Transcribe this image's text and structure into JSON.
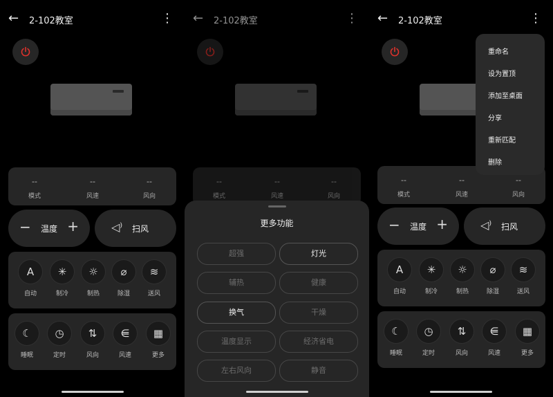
{
  "app": {
    "title": "2-102教室"
  },
  "status": [
    {
      "value": "--",
      "label": "模式"
    },
    {
      "value": "--",
      "label": "风速"
    },
    {
      "value": "--",
      "label": "风向"
    }
  ],
  "temp_label": "温度",
  "swing_label": "扫风",
  "modes": [
    {
      "icon": "A",
      "label": "自动",
      "name": "auto"
    },
    {
      "icon": "✳",
      "label": "制冷",
      "name": "cool"
    },
    {
      "icon": "☼",
      "label": "制热",
      "name": "heat"
    },
    {
      "icon": "⌀",
      "label": "除湿",
      "name": "dry"
    },
    {
      "icon": "≋",
      "label": "送风",
      "name": "fan"
    }
  ],
  "functions": [
    {
      "icon": "☾",
      "label": "睡眠",
      "name": "sleep"
    },
    {
      "icon": "◷",
      "label": "定时",
      "name": "timer"
    },
    {
      "icon": "⇅",
      "label": "风向",
      "name": "direction"
    },
    {
      "icon": "⋹",
      "label": "风速",
      "name": "speed"
    },
    {
      "icon": "▦",
      "label": "更多",
      "name": "more"
    }
  ],
  "sheet": {
    "title": "更多功能",
    "options": [
      {
        "label": "超强",
        "enabled": false
      },
      {
        "label": "灯光",
        "enabled": true
      },
      {
        "label": "辅热",
        "enabled": false
      },
      {
        "label": "健康",
        "enabled": false
      },
      {
        "label": "换气",
        "enabled": true
      },
      {
        "label": "干燥",
        "enabled": false
      },
      {
        "label": "温度显示",
        "enabled": false
      },
      {
        "label": "经济省电",
        "enabled": false
      },
      {
        "label": "左右风向",
        "enabled": false
      },
      {
        "label": "静音",
        "enabled": false
      }
    ]
  },
  "menu": [
    "重命名",
    "设为置顶",
    "添加至桌面",
    "分享",
    "重新匹配",
    "删除"
  ],
  "colors": {
    "power": "#e0322c",
    "background": "#000000",
    "card": "#262626"
  }
}
